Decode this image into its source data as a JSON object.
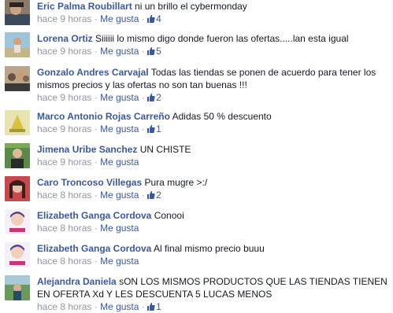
{
  "comments": [
    {
      "author": "Eric Palma Roubillart",
      "text": "ni un brillo el cybermonday",
      "time": "hace 9 horas",
      "like": "Me gusta",
      "likes": "4",
      "avatar": "avatar-photo-man-dark"
    },
    {
      "author": "Lorena Ortiz",
      "text": "Siiiiii lo mismo digo donde fueron las ofertas.....lan esta igual",
      "time": "hace 9 horas",
      "like": "Me gusta",
      "likes": "5",
      "avatar": "avatar-photo-outdoor"
    },
    {
      "author": "Gonzalo Andres Carvajal",
      "text": "Todas las tiendas se ponen de acuerdo para tener los mismos precios y las ofertas no son tan buenas !!!",
      "time": "hace 9 horas",
      "like": "Me gusta",
      "likes": "2",
      "avatar": "avatar-photo-group"
    },
    {
      "author": "Marco Antonio Rojas Carreño",
      "text": "Adidas 50 % descuento",
      "time": "hace 9 horas",
      "like": "Me gusta",
      "likes": "1",
      "avatar": "avatar-photo-yellow"
    },
    {
      "author": "Jimena Uribe Sanchez",
      "text": "UN CHISTE",
      "time": "hace 9 horas",
      "like": "Me gusta",
      "likes": "",
      "avatar": "avatar-photo-green"
    },
    {
      "author": "Caro Troncoso Villegas",
      "text": "Pura mugre >:/",
      "time": "hace 8 horas",
      "like": "Me gusta",
      "likes": "2",
      "avatar": "avatar-photo-woman"
    },
    {
      "author": "Elizabeth Ganga Cordova",
      "text": "Conooi",
      "time": "hace 8 horas",
      "like": "Me gusta",
      "likes": "",
      "avatar": "avatar-photo-cartoon"
    },
    {
      "author": "Elizabeth Ganga Cordova",
      "text": "Al final mismo precio buuu",
      "time": "hace 8 horas",
      "like": "Me gusta",
      "likes": "",
      "avatar": "avatar-photo-cartoon"
    },
    {
      "author": "Alejandra Daniela",
      "text": "sON LOS MISMOS PRODUCTOS QUE LAS TIENDAS TIENEN EN OFERTA Xd Y LES DESCUENTA 5 LUCAS MENOS",
      "time": "hace 8 horas",
      "like": "Me gusta",
      "likes": "1",
      "avatar": "avatar-photo-landscape"
    }
  ],
  "separator": "·",
  "colors": {
    "link": "#3b5998",
    "meta": "#9197a3",
    "text": "#141823"
  }
}
